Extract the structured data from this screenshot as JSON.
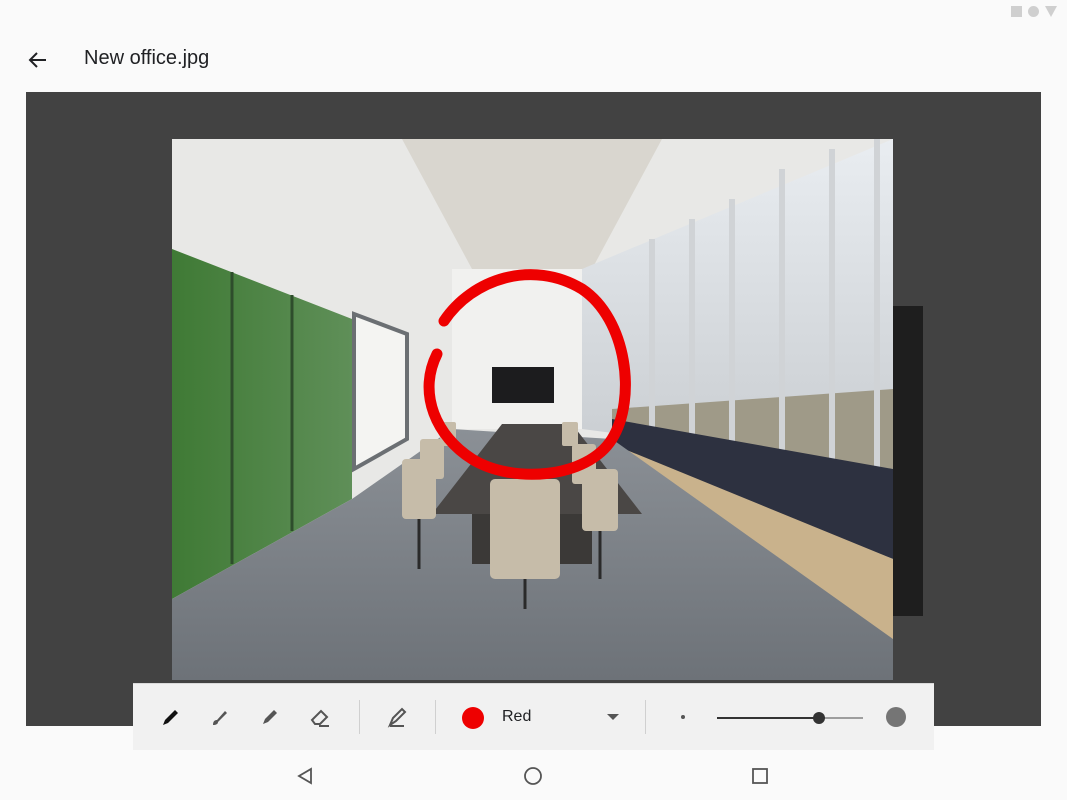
{
  "app": {
    "title": "New office.jpg"
  },
  "image": {
    "description_icon": "office-photo"
  },
  "toolbar": {
    "tools": [
      {
        "name": "pen-icon",
        "selected": true
      },
      {
        "name": "brush-icon",
        "selected": false
      },
      {
        "name": "marker-icon",
        "selected": false
      },
      {
        "name": "eraser-icon",
        "selected": false
      },
      {
        "name": "highlighter-icon",
        "selected": false
      }
    ],
    "color": {
      "label": "Red",
      "value": "#ee0000"
    },
    "stroke_size": 0.7
  },
  "colors": {
    "canvas_bg": "#424242",
    "accent": "#ee0000"
  }
}
